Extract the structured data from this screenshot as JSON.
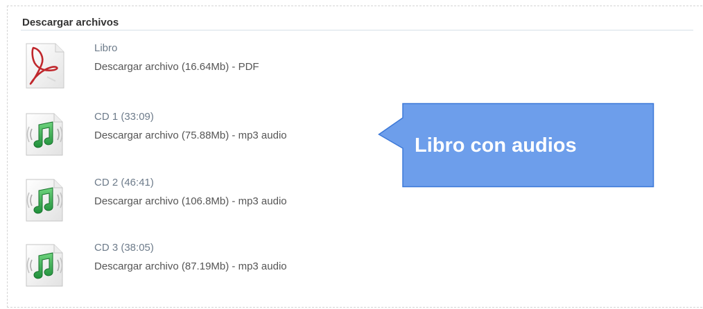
{
  "section": {
    "title": "Descargar archivos"
  },
  "files": [
    {
      "name": "Libro",
      "link": "Descargar archivo (16.64Mb) - PDF",
      "icon": "pdf-document-icon"
    },
    {
      "name": "CD 1 (33:09)",
      "link": "Descargar archivo (75.88Mb) - mp3 audio",
      "icon": "audio-file-icon"
    },
    {
      "name": "CD 2 (46:41)",
      "link": "Descargar archivo (106.8Mb) - mp3 audio",
      "icon": "audio-file-icon"
    },
    {
      "name": "CD 3 (38:05)",
      "link": "Descargar archivo (87.19Mb) - mp3 audio",
      "icon": "audio-file-icon"
    }
  ],
  "callout": {
    "text": "Libro con audios",
    "fill_color": "#6d9eeb",
    "border_color": "#3c78d8"
  },
  "colors": {
    "pdf_red": "#c0282d",
    "music_green": "#2ea84a"
  }
}
